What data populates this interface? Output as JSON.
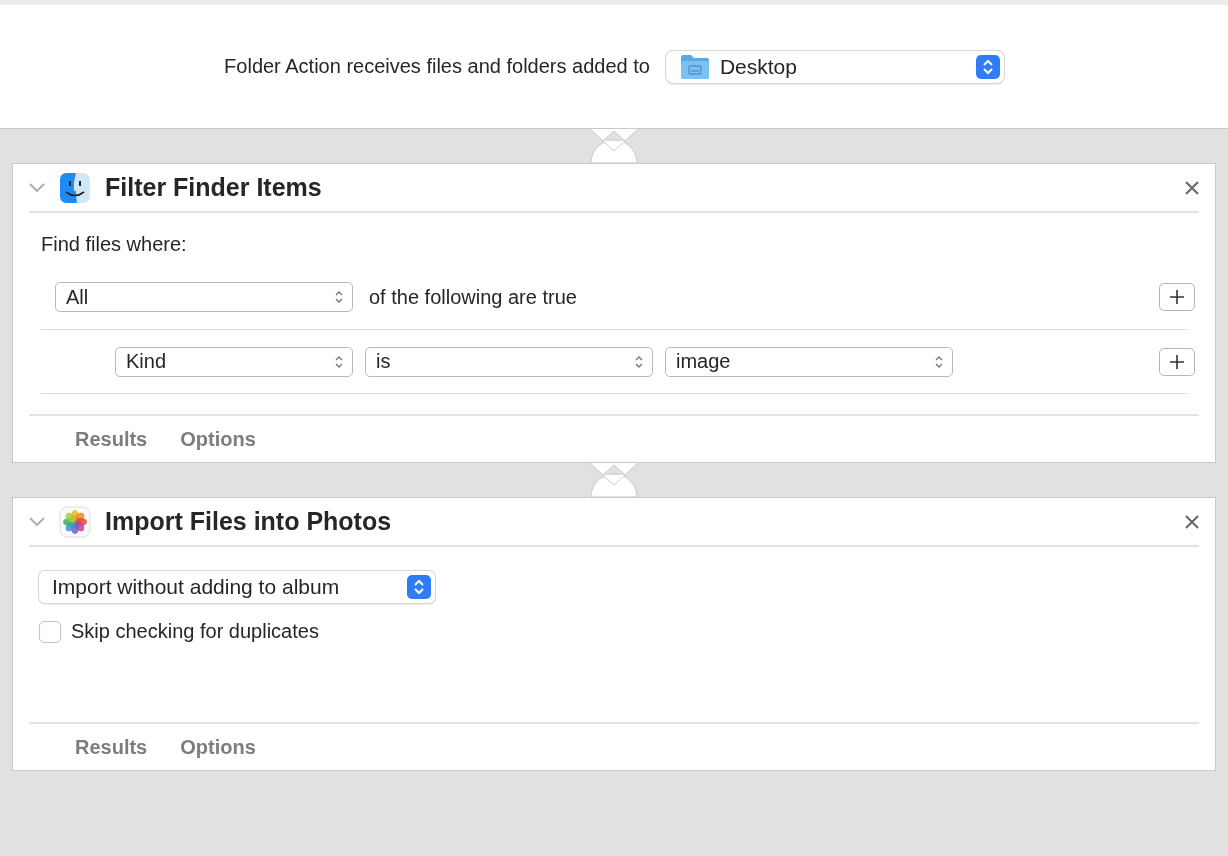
{
  "header": {
    "label": "Folder Action receives files and folders added to",
    "folder_popup": {
      "value": "Desktop"
    }
  },
  "actions": [
    {
      "kind": "filter",
      "title": "Filter Finder Items",
      "intro": "Find files where:",
      "match": {
        "value": "All",
        "suffix": "of the following are true"
      },
      "criteria": [
        {
          "fields": [
            "Kind",
            "is",
            "image"
          ]
        }
      ],
      "footer": [
        "Results",
        "Options"
      ]
    },
    {
      "kind": "import",
      "title": "Import Files into Photos",
      "popup": "Import without adding to album",
      "checkbox": {
        "label": "Skip checking for duplicates",
        "checked": false
      },
      "footer": [
        "Results",
        "Options"
      ]
    }
  ]
}
